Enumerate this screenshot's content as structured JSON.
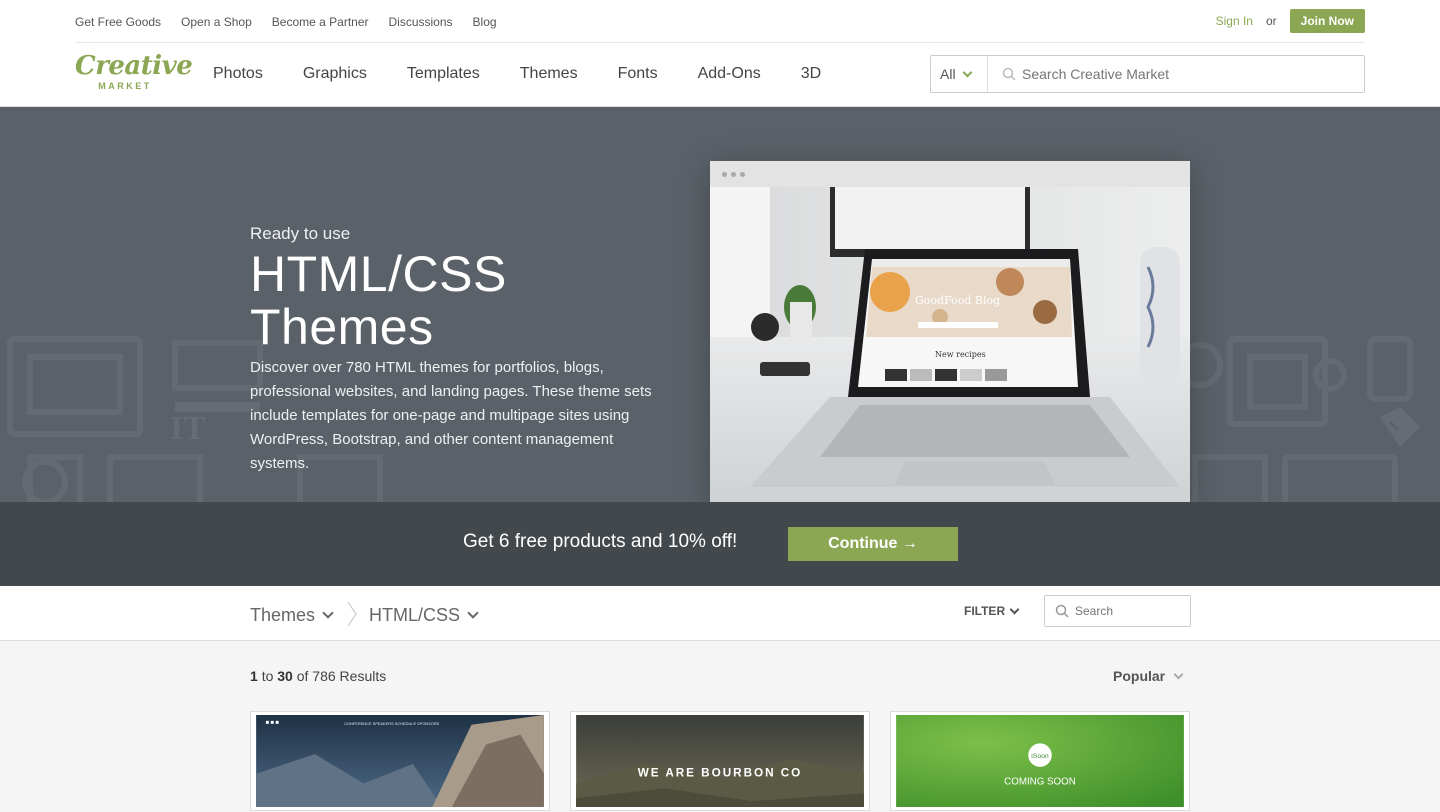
{
  "topbar": {
    "links": [
      "Get Free Goods",
      "Open a Shop",
      "Become a Partner",
      "Discussions",
      "Blog"
    ],
    "sign_in": "Sign In",
    "or": "or",
    "join_now": "Join Now"
  },
  "logo": {
    "word": "Creative",
    "sub": "MARKET"
  },
  "nav": {
    "items": [
      "Photos",
      "Graphics",
      "Templates",
      "Themes",
      "Fonts",
      "Add-Ons",
      "3D"
    ],
    "search_scope": "All",
    "search_placeholder": "Search Creative Market"
  },
  "hero": {
    "kicker": "Ready to use",
    "title_line1": "HTML/CSS",
    "title_line2": "Themes",
    "description": "Discover over 780 HTML themes for portfolios, blogs, professional websites, and landing pages. These theme sets include templates for one-page and multipage sites using WordPress, Bootstrap, and other content management systems.",
    "screen_title": "GoodFood Blog",
    "screen_section": "New recipes"
  },
  "promo": {
    "text": "Get 6 free products and 10% off!",
    "button": "Continue →"
  },
  "filterbar": {
    "crumb_category": "Themes",
    "crumb_subcategory": "HTML/CSS",
    "filter_label": "FILTER",
    "search_placeholder": "Search"
  },
  "results": {
    "from": "1",
    "to_word": "to",
    "to": "30",
    "of_text": "of 786 Results",
    "sort": "Popular"
  },
  "cards": [
    {
      "nav_text": "CONFERENCE   SPEAKERS   SCHEDULE   SPONSORS"
    },
    {
      "headline": "WE ARE BOURBON CO"
    },
    {
      "badge": "iSoon",
      "headline": "COMING SOON"
    }
  ],
  "colors": {
    "brand_green": "#8ba753",
    "hero_bg": "#5a6168",
    "promo_bg": "#43484c"
  }
}
